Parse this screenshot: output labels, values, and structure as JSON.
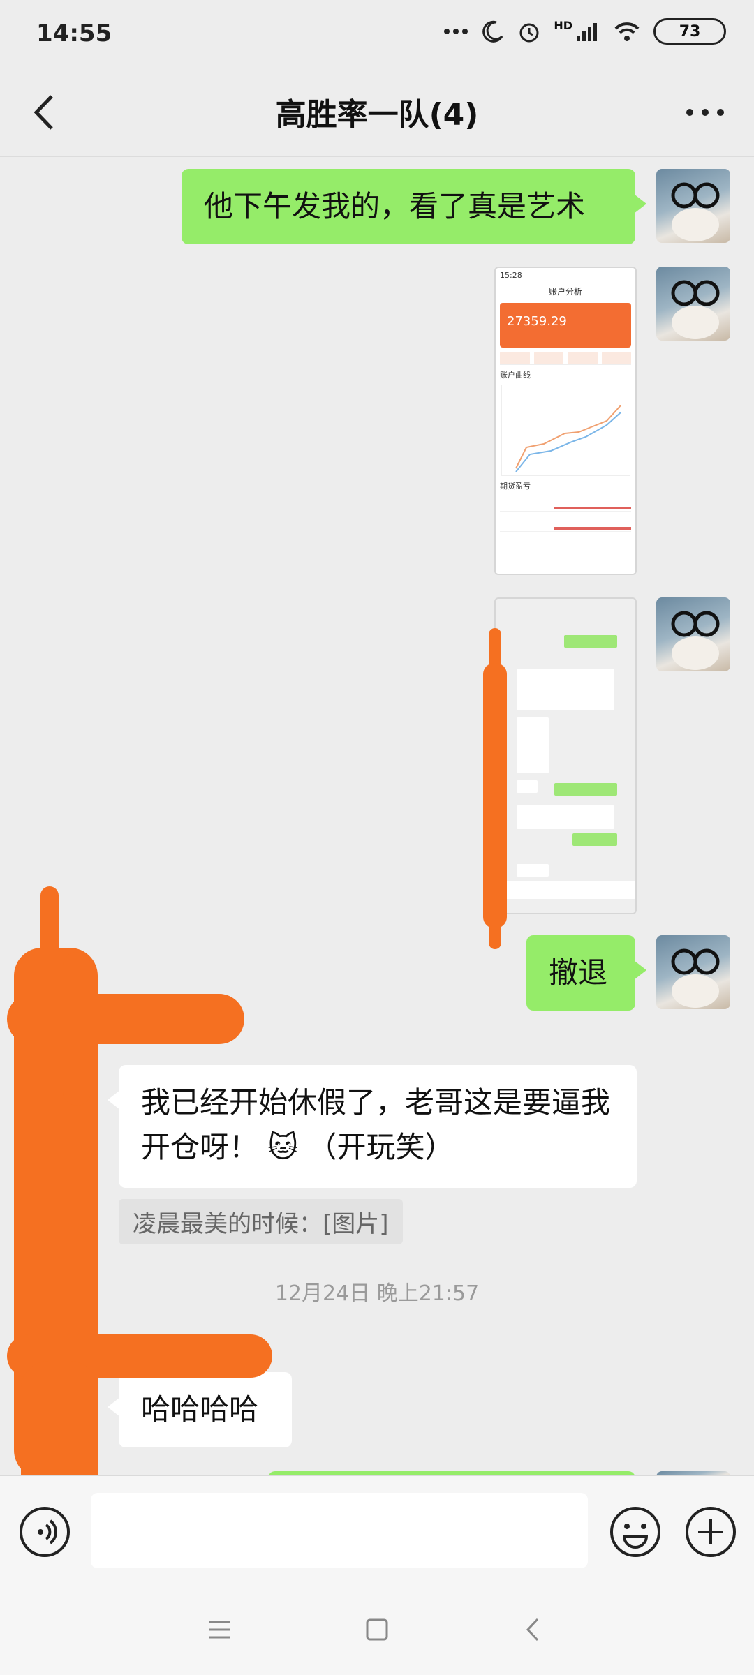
{
  "status_bar": {
    "time": "14:55",
    "network": "HD",
    "battery": "73"
  },
  "header": {
    "title": "高胜率一队(4)"
  },
  "messages": {
    "m1": "他下午发我的，看了真是艺术",
    "m2_image": {
      "time": "15:28",
      "title": "账户分析",
      "amount": "27359.29",
      "section_curve": "账户曲线",
      "section_profit": "期货盈亏"
    },
    "m4": "撤退",
    "m5": "我已经开始休假了，老哥这是要逼我开仓呀！",
    "m5_suffix": "（开玩笑）",
    "m5_emoji": "🐱",
    "quote": "凌晨最美的时候：[图片]",
    "timestamp": "12月24日 晚上21:57",
    "m6": "哈哈哈哈"
  },
  "input": {
    "placeholder": ""
  },
  "colors": {
    "accent_green": "#95ec69",
    "scribble": "#f57021",
    "background": "#ededed"
  },
  "icons": [
    "back-arrow-icon",
    "more-icon",
    "voice-icon",
    "emoji-icon",
    "plus-icon",
    "menu-icon",
    "home-icon",
    "back-nav-icon"
  ]
}
